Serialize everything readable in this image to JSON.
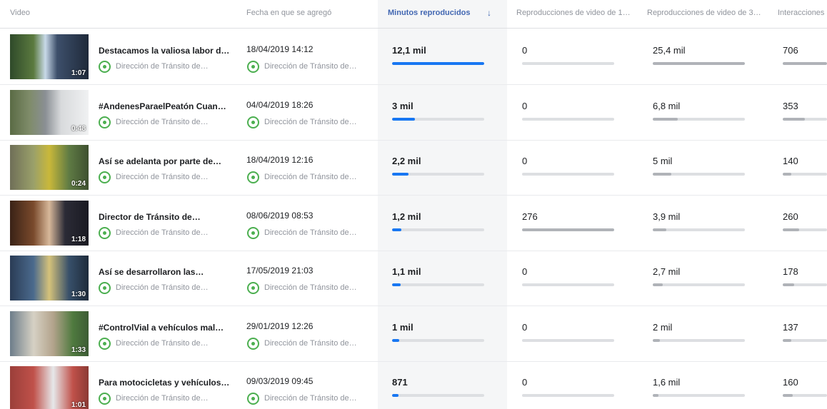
{
  "colors": {
    "accent": "#4267b2",
    "bar_blue": "#1877f2",
    "bar_gray": "#b0b3b8",
    "page_logo": "#4caf50"
  },
  "header": {
    "video": "Video",
    "date_added": "Fecha en que se agregó",
    "minutes_played": "Minutos reproducidos",
    "sort_icon": "arrow-down-icon",
    "views_1": "Reproducciones de video de 1…",
    "views_3": "Reproducciones de video de 3…",
    "interactions": "Interacciones"
  },
  "rows": [
    {
      "duration": "1:07",
      "title": "Destacamos la valiosa labor d…",
      "page": "Dirección de Tránsito de…",
      "date": "18/04/2019 14:12",
      "page2": "Dirección de Tránsito de…",
      "minutes": "12,1 mil",
      "minutes_level": 1.0,
      "views1": "0",
      "views1_level": 0.0,
      "views3": "25,4 mil",
      "views3_level": 1.0,
      "interactions": "706",
      "interactions_level": 1.0
    },
    {
      "duration": "0:48",
      "title": "#AndenesParaelPeatón Cuan…",
      "page": "Dirección de Tránsito de…",
      "date": "04/04/2019 18:26",
      "page2": "Dirección de Tránsito de…",
      "minutes": "3 mil",
      "minutes_level": 0.25,
      "views1": "0",
      "views1_level": 0.0,
      "views3": "6,8 mil",
      "views3_level": 0.27,
      "interactions": "353",
      "interactions_level": 0.5
    },
    {
      "duration": "0:24",
      "title": "Así se adelanta por parte de…",
      "page": "Dirección de Tránsito de…",
      "date": "18/04/2019 12:16",
      "page2": "Dirección de Tránsito de…",
      "minutes": "2,2 mil",
      "minutes_level": 0.18,
      "views1": "0",
      "views1_level": 0.0,
      "views3": "5 mil",
      "views3_level": 0.2,
      "interactions": "140",
      "interactions_level": 0.2
    },
    {
      "duration": "1:18",
      "title": "Director de Tránsito de…",
      "page": "Dirección de Tránsito de…",
      "date": "08/06/2019 08:53",
      "page2": "Dirección de Tránsito de…",
      "minutes": "1,2 mil",
      "minutes_level": 0.1,
      "views1": "276",
      "views1_level": 1.0,
      "views3": "3,9 mil",
      "views3_level": 0.15,
      "interactions": "260",
      "interactions_level": 0.37
    },
    {
      "duration": "1:30",
      "title": "Así se desarrollaron las…",
      "page": "Dirección de Tránsito de…",
      "date": "17/05/2019 21:03",
      "page2": "Dirección de Tránsito de…",
      "minutes": "1,1 mil",
      "minutes_level": 0.09,
      "views1": "0",
      "views1_level": 0.0,
      "views3": "2,7 mil",
      "views3_level": 0.11,
      "interactions": "178",
      "interactions_level": 0.25
    },
    {
      "duration": "1:33",
      "title": "#ControlVial a vehículos mal…",
      "page": "Dirección de Tránsito de…",
      "date": "29/01/2019 12:26",
      "page2": "Dirección de Tránsito de…",
      "minutes": "1 mil",
      "minutes_level": 0.08,
      "views1": "0",
      "views1_level": 0.0,
      "views3": "2 mil",
      "views3_level": 0.08,
      "interactions": "137",
      "interactions_level": 0.19
    },
    {
      "duration": "1:01",
      "title": "Para motocicletas y vehículos…",
      "page": "Dirección de Tránsito de…",
      "date": "09/03/2019 09:45",
      "page2": "Dirección de Tránsito de…",
      "minutes": "871",
      "minutes_level": 0.07,
      "views1": "0",
      "views1_level": 0.0,
      "views3": "1,6 mil",
      "views3_level": 0.06,
      "interactions": "160",
      "interactions_level": 0.23
    }
  ]
}
